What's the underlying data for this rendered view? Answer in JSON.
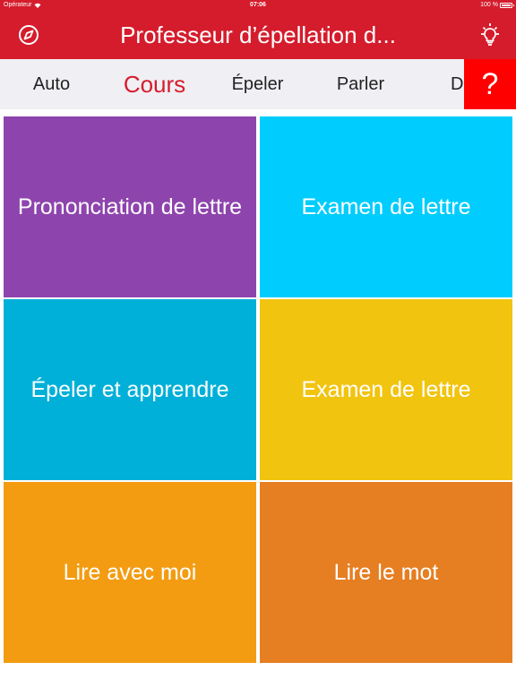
{
  "status_bar": {
    "carrier": "Opérateur",
    "time": "07:06",
    "battery": "100 %"
  },
  "nav": {
    "title": "Professeur d’épellation d...",
    "left_icon": "compass-icon",
    "right_icon": "lightbulb-icon"
  },
  "tabs": [
    {
      "label": "Auto"
    },
    {
      "label": "Cours"
    },
    {
      "label": "Épeler"
    },
    {
      "label": "Parler"
    },
    {
      "label": "Dic"
    }
  ],
  "active_tab": "Cours",
  "help_button": {
    "label": "?"
  },
  "tiles": [
    {
      "label": "Prononciation de lettre",
      "color": "#8e44ad"
    },
    {
      "label": "Examen de lettre",
      "color": "#00cdfd"
    },
    {
      "label": "Épeler et apprendre",
      "color": "#00b0d8"
    },
    {
      "label": "Examen de lettre",
      "color": "#f1c40f"
    },
    {
      "label": "Lire avec moi",
      "color": "#f39c12"
    },
    {
      "label": "Lire le mot",
      "color": "#e67e22"
    }
  ],
  "colors": {
    "brand_red": "#d51c2c",
    "help_red": "#ff0000",
    "tab_bar_bg": "#efeff4"
  }
}
